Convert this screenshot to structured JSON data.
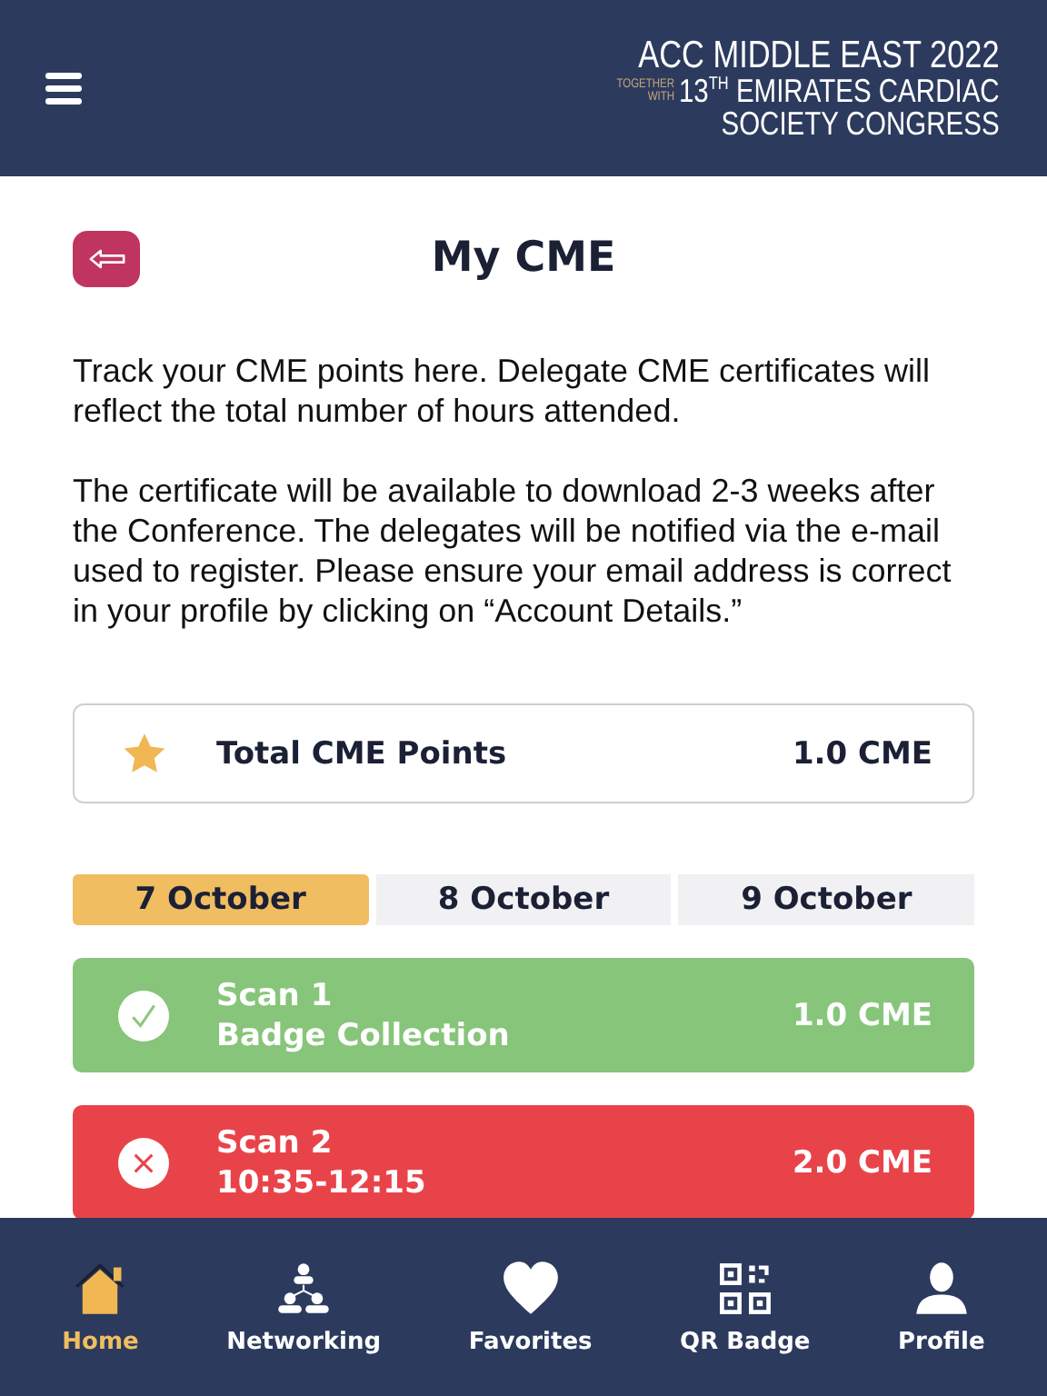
{
  "header": {
    "logo": {
      "title": "ACC MIDDLE EAST 2022",
      "together": "TOGETHER",
      "with": "WITH",
      "number": "13",
      "ordinal": "TH",
      "line2": "EMIRATES CARDIAC",
      "line3": "SOCIETY CONGRESS"
    }
  },
  "page": {
    "title": "My CME"
  },
  "paragraphs": [
    "Track your CME points here. Delegate CME certificates will reflect the total number of hours attended.",
    "The certificate will be available to download 2-3 weeks after the Conference. The delegates will be notified via the e-mail used to register. Please ensure your email address is correct in your profile by clicking on “Account Details.”"
  ],
  "total": {
    "label": "Total CME Points",
    "value": "1.0 CME"
  },
  "day_tabs": [
    {
      "label": "7 October",
      "selected": true
    },
    {
      "label": "8 October",
      "selected": false
    },
    {
      "label": "9 October",
      "selected": false
    }
  ],
  "scans": [
    {
      "kind": "attended",
      "title": "Scan 1",
      "subtitle": "Badge Collection",
      "value": "1.0 CME"
    },
    {
      "kind": "missed",
      "title": "Scan 2",
      "subtitle": "10:35-12:15",
      "value": "2.0 CME"
    }
  ],
  "nav": [
    {
      "kind": "home",
      "label": "Home",
      "selected": true
    },
    {
      "kind": "networking",
      "label": "Networking",
      "selected": false
    },
    {
      "kind": "favorites",
      "label": "Favorites",
      "selected": false
    },
    {
      "kind": "qr",
      "label": "QR Badge",
      "selected": false
    },
    {
      "kind": "profile",
      "label": "Profile",
      "selected": false
    }
  ]
}
